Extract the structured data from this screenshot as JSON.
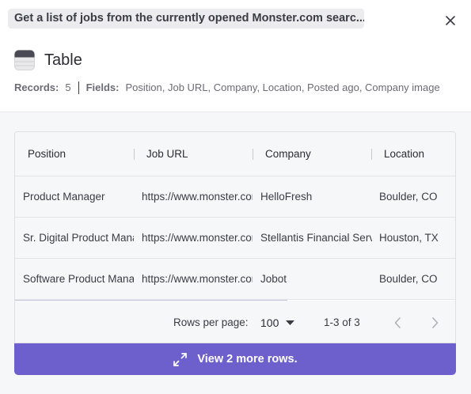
{
  "header": {
    "task_chip": "Get a list of jobs from the currently opened Monster.com searc...",
    "close_icon": "close-icon"
  },
  "title": {
    "icon": "table-icon",
    "text": "Table"
  },
  "meta": {
    "records_label": "Records:",
    "records_value": "5",
    "fields_label": "Fields:",
    "fields_value": "Position, Job URL, Company, Location, Posted ago, Company image"
  },
  "table": {
    "columns": [
      "Position",
      "Job URL",
      "Company",
      "Location"
    ],
    "rows": [
      [
        "Product Manager",
        "https://www.monster.com",
        "HelloFresh",
        "Boulder, CO"
      ],
      [
        "Sr. Digital Product Manager",
        "https://www.monster.com",
        "Stellantis Financial Services",
        "Houston, TX"
      ],
      [
        "Software Product Manager",
        "https://www.monster.com",
        "Jobot",
        "Boulder, CO"
      ]
    ]
  },
  "pagination": {
    "rows_per_page_label": "Rows per page:",
    "rows_per_page_value": "100",
    "range_text": "1-3 of 3",
    "prev_icon": "chevron-left-icon",
    "next_icon": "chevron-right-icon"
  },
  "view_more": {
    "label": "View 2 more rows.",
    "icon": "expand-icon"
  },
  "colors": {
    "accent": "#6d60cc",
    "chip_bg": "#ececef",
    "panel_bg": "#f6f7f9"
  }
}
